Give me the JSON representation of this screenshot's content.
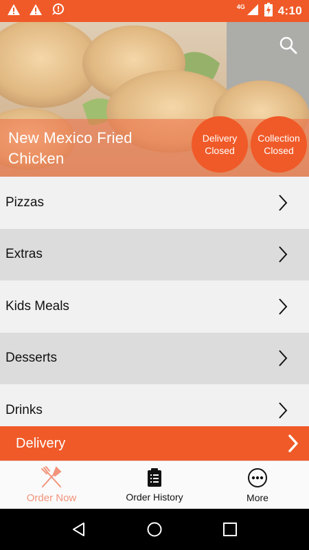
{
  "status_bar": {
    "time": "4:10",
    "network": "4G",
    "icons": [
      "warning-icon",
      "warning-icon",
      "alert-bubble-icon",
      "signal-icon",
      "battery-charging-icon"
    ]
  },
  "restaurant": {
    "name": "New Mexico Fried Chicken",
    "delivery_status": {
      "line1": "Delivery",
      "line2": "Closed"
    },
    "collection_status": {
      "line1": "Collection",
      "line2": "Closed"
    }
  },
  "menu": {
    "categories": [
      {
        "label": "Pizzas"
      },
      {
        "label": "Extras"
      },
      {
        "label": "Kids Meals"
      },
      {
        "label": "Desserts"
      },
      {
        "label": "Drinks"
      }
    ]
  },
  "delivery_bar": {
    "label": "Delivery"
  },
  "bottom_nav": {
    "tabs": [
      {
        "label": "Order Now",
        "icon": "fork-knife-icon",
        "active": true
      },
      {
        "label": "Order History",
        "icon": "clipboard-icon",
        "active": false
      },
      {
        "label": "More",
        "icon": "more-dots-icon",
        "active": false
      }
    ]
  },
  "colors": {
    "accent": "#f05a28",
    "active_tab": "#f2937a",
    "row_light": "#f1f1f1",
    "row_dark": "#dcdcdc"
  }
}
